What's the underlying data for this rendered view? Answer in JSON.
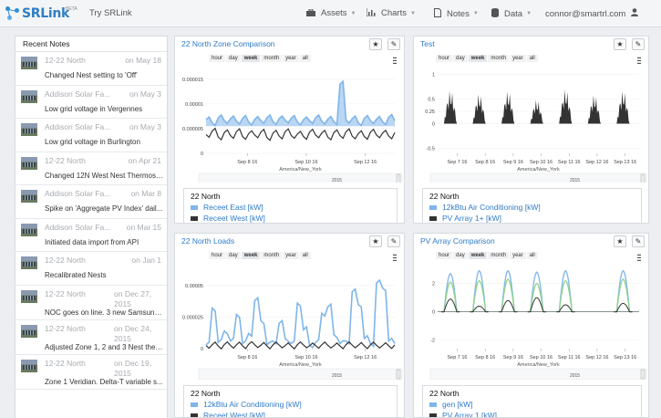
{
  "brand": {
    "name": "SRLink",
    "beta": "BETA",
    "try_link": "Try SRLink"
  },
  "nav": [
    {
      "label": "Assets",
      "icon": "briefcase-icon"
    },
    {
      "label": "Charts",
      "icon": "bar-chart-icon"
    },
    {
      "label": "Notes",
      "icon": "document-icon"
    },
    {
      "label": "Data",
      "icon": "database-icon"
    }
  ],
  "user": {
    "email": "connor@smartrl.com",
    "icon": "user-icon"
  },
  "sidebar": {
    "title": "Recent Notes",
    "notes": [
      {
        "source": "12-22 North",
        "date": "on May 18",
        "text": "Changed Nest setting to 'Off'"
      },
      {
        "source": "Addison Solar Fa...",
        "date": "on May 3",
        "text": "Low grid voltage in Vergennes"
      },
      {
        "source": "Addison Solar Fa...",
        "date": "on May 3",
        "text": "Low grid voltage in Burlington"
      },
      {
        "source": "12-22 North",
        "date": "on Apr 21",
        "text": "Changed 12N West Nest Thermost..."
      },
      {
        "source": "Addison Solar Fa...",
        "date": "on Mar 8",
        "text": "Spike on 'Aggregate PV Index' dail..."
      },
      {
        "source": "Addison Solar Fa...",
        "date": "on Mar 15",
        "text": "Initiated data import from API"
      },
      {
        "source": "12-22 North",
        "date": "on Jan 1",
        "text": "Recalibrated Nests"
      },
      {
        "source": "12-22 North",
        "date": "on Dec 27, 2015",
        "text": "NOC goes on line. 3 new Samsung..."
      },
      {
        "source": "12-22 North",
        "date": "on Dec 24, 2015",
        "text": "Adjusted Zone 1, 2 and 3 Nest ther..."
      },
      {
        "source": "12-22 North",
        "date": "on Dec 19, 2015",
        "text": "Zone 1 Veridian. Delta-T variable s..."
      }
    ]
  },
  "ranges": [
    "hour",
    "day",
    "week",
    "month",
    "year",
    "all"
  ],
  "range_selected": "week",
  "icons": {
    "star": "star-icon",
    "edit": "pencil-icon",
    "menu": "hamburger-menu-icon"
  },
  "colors": {
    "series_blue": "#7fb5ea",
    "series_dark": "#333333",
    "series_green": "#90d48b",
    "link": "#2f7bc9"
  },
  "panels": [
    {
      "id": "p1",
      "title": "22 North Zone Comparison",
      "legend_title": "22 North",
      "legend": [
        {
          "name": "Receet East [kW]",
          "color": "#7fb5ea"
        },
        {
          "name": "Receet West [kW]",
          "color": "#333333"
        }
      ],
      "chart_data": {
        "type": "line",
        "yticks": [
          "0.000015",
          "0.00001",
          "0.000005",
          "0"
        ],
        "ylim": [
          0,
          1.7e-05
        ],
        "xticks": [
          "Sep 8 16",
          "Sep 10 16",
          "Sep 12 16"
        ],
        "timezone": "America/New_York",
        "navigator_label": "2015",
        "series": [
          {
            "color": "#7fb5ea",
            "values": [
              6.8e-06,
              6.2e-06,
              7.2e-06,
              6.6e-06,
              7e-06,
              6.5e-06,
              7.1e-06,
              6.3e-06,
              6.9e-06,
              6.6e-06,
              7.2e-06,
              6.4e-06,
              7e-06,
              6.7e-06,
              7.1e-06,
              6.3e-06,
              6.8e-06,
              6.6e-06,
              7.2e-06,
              6.5e-06,
              6.9e-06,
              6.4e-06,
              1.4e-05,
              6.7e-06,
              7e-06,
              6.2e-06,
              7.1e-06,
              6.6e-06,
              6.9e-06,
              6.4e-06,
              7.3e-06,
              6.6e-06
            ]
          },
          {
            "color": "#333333",
            "values": [
              3.8e-06,
              4.5e-06,
              3.3e-06,
              4.2e-06,
              3.6e-06,
              4.4e-06,
              3.4e-06,
              4e-06,
              3.7e-06,
              4.3e-06,
              3.2e-06,
              4.1e-06,
              3.5e-06,
              4.4e-06,
              3.6e-06,
              3.9e-06,
              3.4e-06,
              4.3e-06,
              3.7e-06,
              4.1e-06,
              3.3e-06,
              4.2e-06,
              3.6e-06,
              4.4e-06,
              3.5e-06,
              4e-06,
              3.4e-06,
              4.3e-06,
              3.7e-06,
              4.1e-06,
              3.5e-06,
              4.2e-06
            ]
          }
        ]
      }
    },
    {
      "id": "p2",
      "title": "Test",
      "legend_title": "22 North",
      "legend": [
        {
          "name": "12kBtu Air Conditioning [kW]",
          "color": "#7fb5ea"
        },
        {
          "name": "PV Array 1+ [kW]",
          "color": "#333333"
        }
      ],
      "chart_data": {
        "type": "area",
        "yticks": [
          "1",
          "0.5",
          "0.25",
          "0",
          "-0.5"
        ],
        "ylim": [
          -0.6,
          1.1
        ],
        "xticks": [
          "Sep 7 16",
          "Sep 8 16",
          "Sep 9 16",
          "Sep 10 16",
          "Sep 11 16",
          "Sep 12 16",
          "Sep 13 16"
        ],
        "timezone": "America/New_York",
        "navigator_label": "2015",
        "series": [
          {
            "color": "#333333",
            "peaks": [
              0.7,
              0.62,
              0.68,
              0.5,
              0.72,
              0.6,
              0.69
            ]
          }
        ]
      }
    },
    {
      "id": "p3",
      "title": "22 North Loads",
      "legend_title": "22 North",
      "legend": [
        {
          "name": "12kBtu Air Conditioning [kW]",
          "color": "#7fb5ea"
        },
        {
          "name": "Receet West [kW]",
          "color": "#333333"
        }
      ],
      "chart_data": {
        "type": "line",
        "yticks": [
          "0.00005",
          "0.000025",
          "0"
        ],
        "ylim": [
          0,
          6.5e-05
        ],
        "xticks": [
          "Sep 8 16",
          "Sep 10 16",
          "Sep 12 16"
        ],
        "timezone": "America/New_York",
        "navigator_label": "2015",
        "series": [
          {
            "color": "#7fb5ea",
            "values": [
              3e-06,
              3.2e-05,
              5e-06,
              1.4e-05,
              6e-06,
              2.7e-05,
              4e-06,
              1.2e-05,
              3.8e-05,
              2.2e-05,
              3e-06,
              6e-06,
              2e-05,
              8e-06,
              4e-06,
              3.6e-05,
              1.5e-05,
              3e-06,
              5e-06,
              2.8e-05,
              3.3e-05,
              1.1e-05,
              4e-06,
              6e-06,
              4.5e-05,
              3.5e-05,
              8e-06,
              4e-06,
              5.2e-05,
              4.8e-05,
              6e-06,
              4e-06
            ]
          },
          {
            "color": "#333333",
            "values": [
              2.5e-06,
              3e-06,
              2e-06,
              3.2e-06,
              2.6e-06,
              3e-06,
              2.2e-06,
              3.4e-06,
              3e-06,
              2.7e-06,
              2.1e-06,
              3e-06,
              2.8e-06,
              2.4e-06,
              2e-06,
              3.1e-06,
              2.9e-06,
              2.2e-06,
              2.5e-06,
              3e-06,
              2.7e-06,
              2.3e-06,
              2.1e-06,
              3.2e-06,
              2.8e-06,
              2.6e-06,
              2.2e-06,
              3e-06,
              2.7e-06,
              2.5e-06,
              2.3e-06,
              3e-06
            ]
          }
        ]
      }
    },
    {
      "id": "p4",
      "title": "PV Array Comparison",
      "legend_title": "22 North",
      "legend": [
        {
          "name": "gen [kW]",
          "color": "#7fb5ea"
        },
        {
          "name": "PV Array 1 [kW]",
          "color": "#333333"
        }
      ],
      "chart_data": {
        "type": "line",
        "yticks": [
          "2",
          "0",
          "-2"
        ],
        "ylim": [
          -2.6,
          3.2
        ],
        "xticks": [
          "Sep 7 16",
          "Sep 8 16",
          "Sep 9 16",
          "Sep 10 16",
          "Sep 11 16",
          "Sep 12 16",
          "Sep 13 16"
        ],
        "timezone": "America/New_York",
        "navigator_label": "2015",
        "series": [
          {
            "color": "#7fb5ea",
            "peaks": [
              2.7,
              2.9,
              2.9,
              2.8,
              2.9,
              0,
              2.9
            ]
          },
          {
            "color": "#90d48b",
            "peaks": [
              2.1,
              2.2,
              2.3,
              2.0,
              2.2,
              0,
              2.3
            ]
          },
          {
            "color": "#333333",
            "peaks": [
              0.9,
              0.4,
              0.8,
              1.0,
              0.5,
              0,
              0.6
            ]
          }
        ]
      }
    }
  ]
}
